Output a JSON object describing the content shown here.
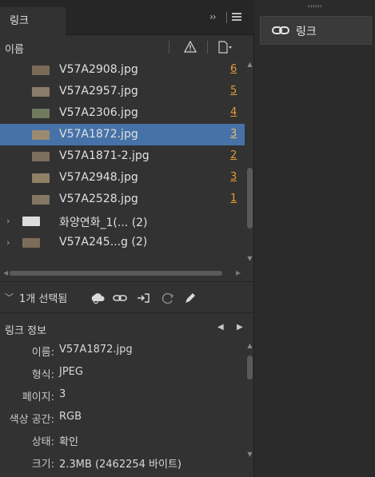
{
  "panel": {
    "tab_label": "링크",
    "collapse_glyph": "››",
    "column_name": "이름"
  },
  "links": [
    {
      "name": "V57A2908.jpg",
      "page": "6",
      "thumb": "#7a6a58",
      "selected": false
    },
    {
      "name": "V57A2957.jpg",
      "page": "5",
      "thumb": "#8a7c6a",
      "selected": false
    },
    {
      "name": "V57A2306.jpg",
      "page": "4",
      "thumb": "#6f7a5e",
      "selected": false
    },
    {
      "name": "V57A1872.jpg",
      "page": "3",
      "thumb": "#9c8a70",
      "selected": true
    },
    {
      "name": "V57A1871-2.jpg",
      "page": "2",
      "thumb": "#7d6f5e",
      "selected": false
    },
    {
      "name": "V57A2948.jpg",
      "page": "3",
      "thumb": "#8f8066",
      "selected": false
    },
    {
      "name": "V57A2528.jpg",
      "page": "1",
      "thumb": "#857663",
      "selected": false
    }
  ],
  "groups": [
    {
      "name": "화양연화_1(... (2)",
      "thumb": "#dcdcdc"
    },
    {
      "name": "V57A245...g (2)",
      "thumb": "#7b6d5a"
    }
  ],
  "status": {
    "text": "1개 선택됨"
  },
  "info": {
    "title": "링크 정보",
    "rows": [
      {
        "label": "이름:",
        "value": "V57A1872.jpg"
      },
      {
        "label": "형식:",
        "value": "JPEG"
      },
      {
        "label": "페이지:",
        "value": "3"
      },
      {
        "label": "색상 공간:",
        "value": "RGB"
      },
      {
        "label": "상태:",
        "value": "확인"
      },
      {
        "label": "크기:",
        "value": "2.3MB (2462254 바이트)"
      }
    ]
  },
  "right_panel": {
    "title": "링크"
  }
}
